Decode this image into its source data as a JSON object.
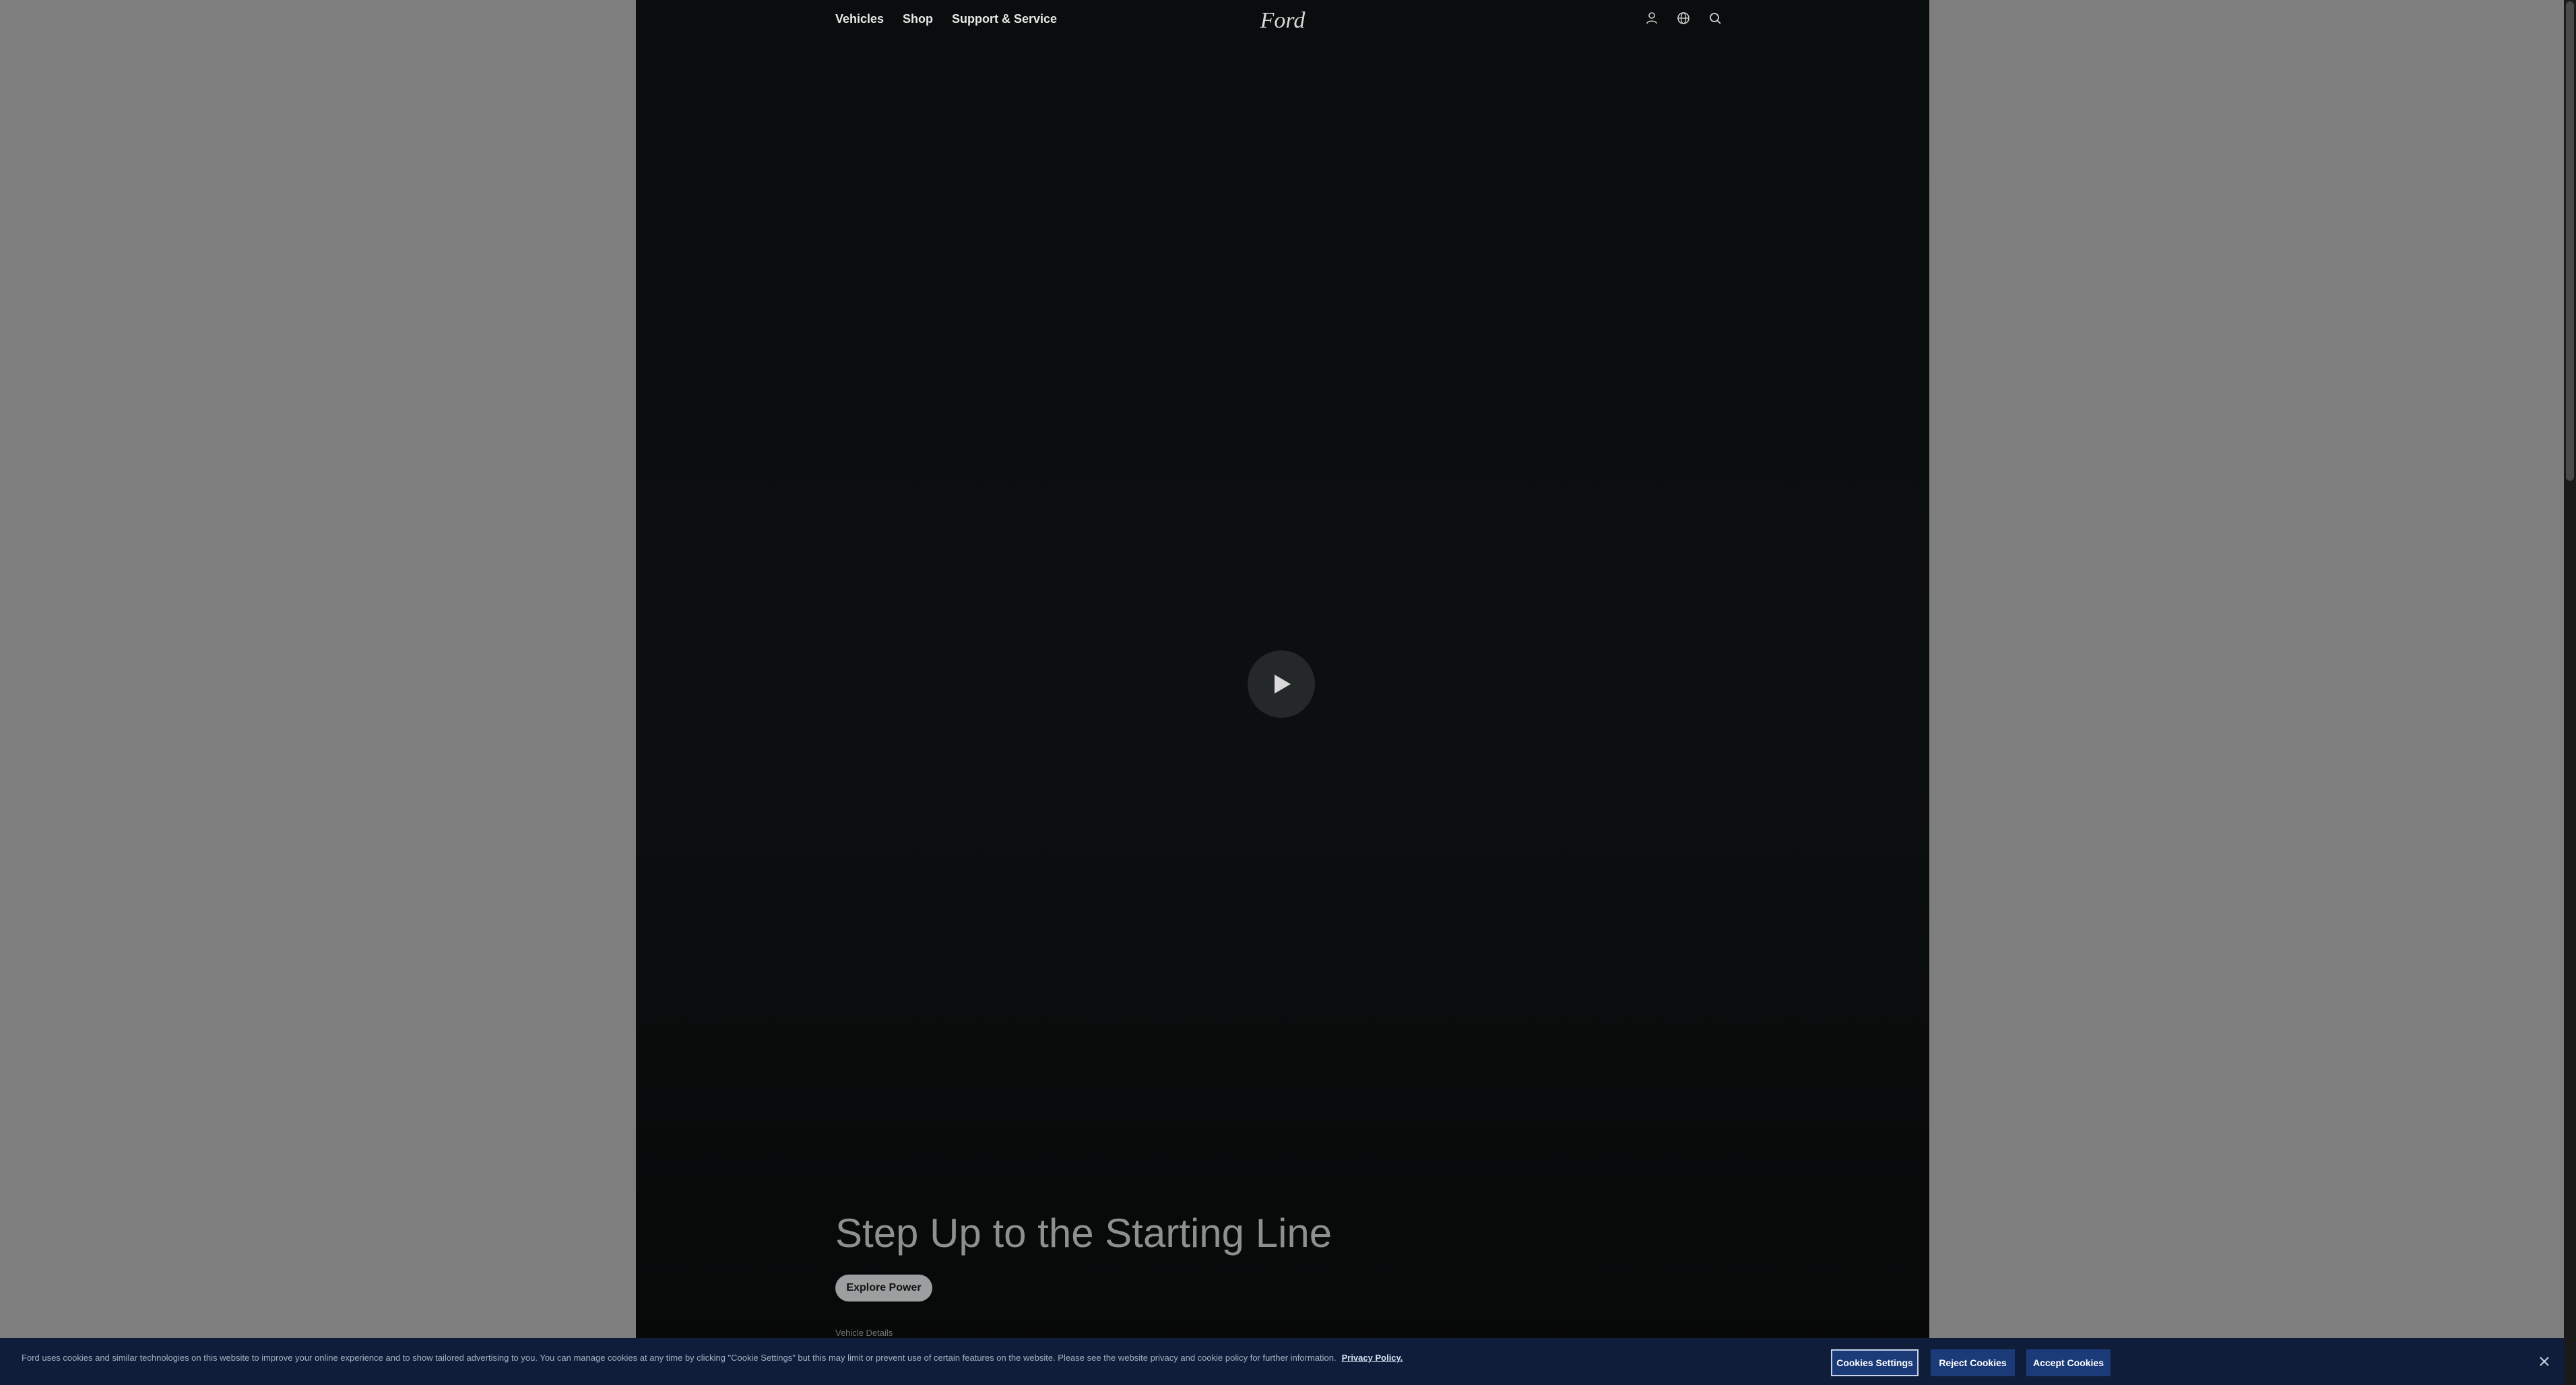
{
  "nav": {
    "links": [
      {
        "label": "Vehicles"
      },
      {
        "label": "Shop"
      },
      {
        "label": "Support & Service"
      }
    ],
    "logo_text": "Ford",
    "icons": [
      "account-icon",
      "globe-icon",
      "search-icon"
    ]
  },
  "video": {
    "play_icon": "play-icon"
  },
  "hero": {
    "title": "Step Up to the Starting Line",
    "cta_label": "Explore Power",
    "details_label": "Vehicle Details"
  },
  "cookie_banner": {
    "text": "Ford uses cookies and similar technologies on this website to improve your online experience and to show tailored advertising to you. You can manage cookies at any time by clicking \"Cookie Settings\" but this may limit or prevent use of certain features on the website. Please see the website privacy and cookie policy for further information.",
    "privacy_link": "Privacy Policy.",
    "settings_label": "Cookies Settings",
    "reject_label": "Reject Cookies",
    "accept_label": "Accept Cookies",
    "close_icon": "close-icon"
  },
  "colors": {
    "page_background": "#7e7e7e",
    "hero_background": "#0b0e0f",
    "banner_background": "#0f1d3a",
    "button_blue": "#1b3b78"
  }
}
